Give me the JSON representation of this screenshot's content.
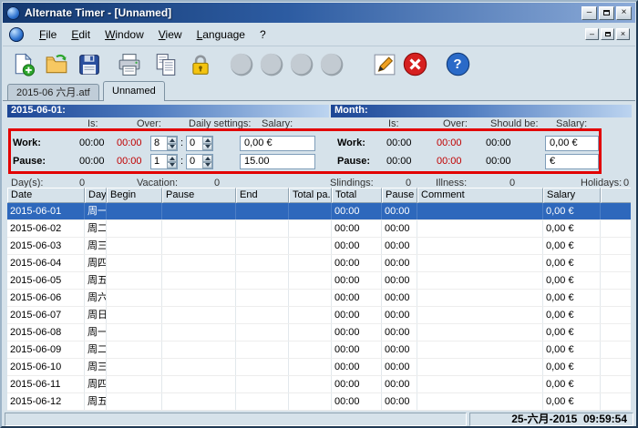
{
  "window": {
    "title": "Alternate Timer - [Unnamed]",
    "controls": {
      "minimize": "–",
      "close": "×"
    }
  },
  "menu": {
    "items": [
      "File",
      "Edit",
      "Window",
      "View",
      "Language",
      "?"
    ],
    "mdi": {
      "minimize": "–",
      "close": "×"
    }
  },
  "toolbar": {
    "buttons": [
      "new-file",
      "open-file",
      "save-file",
      "print",
      "copy",
      "lock",
      "daytype-circle-1",
      "daytype-circle-2",
      "daytype-circle-3",
      "daytype-circle-4",
      "edit-notes",
      "close-file",
      "help"
    ],
    "help_glyph": "?"
  },
  "tabs": [
    {
      "label": "2015-06 六月.atf"
    },
    {
      "label": "Unnamed"
    }
  ],
  "day_section": {
    "header": "2015-06-01:",
    "labels": {
      "is": "Is:",
      "over": "Over:",
      "daily": "Daily settings:",
      "salary": "Salary:"
    },
    "colon": ":",
    "work": {
      "label": "Work:",
      "is": "00:00",
      "over": "00:00",
      "hours": "8",
      "minutes": "0",
      "salary": "0,00 €"
    },
    "pause": {
      "label": "Pause:",
      "is": "00:00",
      "over": "00:00",
      "hours": "1",
      "minutes": "0",
      "salary": "15.00"
    }
  },
  "month_section": {
    "header": "Month:",
    "labels": {
      "is": "Is:",
      "over": "Over:",
      "should": "Should be:",
      "salary": "Salary:"
    },
    "work": {
      "label": "Work:",
      "is": "00:00",
      "over": "00:00",
      "should": "00:00",
      "salary": "0,00 €"
    },
    "pause": {
      "label": "Pause:",
      "is": "00:00",
      "over": "00:00",
      "should": "00:00",
      "salary": "€"
    }
  },
  "stats": {
    "days": {
      "label": "Day(s):",
      "value": "0"
    },
    "vacation": {
      "label": "Vacation:",
      "value": "0"
    },
    "slindings": {
      "label": "Slindings:",
      "value": "0"
    },
    "illness": {
      "label": "Illness:",
      "value": "0"
    },
    "holidays": {
      "label": "Holidays:",
      "value": "0"
    }
  },
  "table": {
    "columns": [
      "Date",
      "Day",
      "Begin",
      "Pause",
      "End",
      "Total pa...",
      "Total",
      "Pause",
      "Comment",
      "Salary"
    ],
    "rows": [
      {
        "date": "2015-06-01",
        "day": "周一",
        "begin": "",
        "pause_begin": "",
        "end": "",
        "total_pause": "",
        "total": "00:00",
        "pause": "00:00",
        "comment": "",
        "salary": "0,00 €",
        "selected": true
      },
      {
        "date": "2015-06-02",
        "day": "周二",
        "begin": "",
        "pause_begin": "",
        "end": "",
        "total_pause": "",
        "total": "00:00",
        "pause": "00:00",
        "comment": "",
        "salary": "0,00 €",
        "selected": false
      },
      {
        "date": "2015-06-03",
        "day": "周三",
        "begin": "",
        "pause_begin": "",
        "end": "",
        "total_pause": "",
        "total": "00:00",
        "pause": "00:00",
        "comment": "",
        "salary": "0,00 €",
        "selected": false
      },
      {
        "date": "2015-06-04",
        "day": "周四",
        "begin": "",
        "pause_begin": "",
        "end": "",
        "total_pause": "",
        "total": "00:00",
        "pause": "00:00",
        "comment": "",
        "salary": "0,00 €",
        "selected": false
      },
      {
        "date": "2015-06-05",
        "day": "周五",
        "begin": "",
        "pause_begin": "",
        "end": "",
        "total_pause": "",
        "total": "00:00",
        "pause": "00:00",
        "comment": "",
        "salary": "0,00 €",
        "selected": false
      },
      {
        "date": "2015-06-06",
        "day": "周六",
        "begin": "",
        "pause_begin": "",
        "end": "",
        "total_pause": "",
        "total": "00:00",
        "pause": "00:00",
        "comment": "",
        "salary": "0,00 €",
        "selected": false
      },
      {
        "date": "2015-06-07",
        "day": "周日",
        "begin": "",
        "pause_begin": "",
        "end": "",
        "total_pause": "",
        "total": "00:00",
        "pause": "00:00",
        "comment": "",
        "salary": "0,00 €",
        "selected": false
      },
      {
        "date": "2015-06-08",
        "day": "周一",
        "begin": "",
        "pause_begin": "",
        "end": "",
        "total_pause": "",
        "total": "00:00",
        "pause": "00:00",
        "comment": "",
        "salary": "0,00 €",
        "selected": false
      },
      {
        "date": "2015-06-09",
        "day": "周二",
        "begin": "",
        "pause_begin": "",
        "end": "",
        "total_pause": "",
        "total": "00:00",
        "pause": "00:00",
        "comment": "",
        "salary": "0,00 €",
        "selected": false
      },
      {
        "date": "2015-06-10",
        "day": "周三",
        "begin": "",
        "pause_begin": "",
        "end": "",
        "total_pause": "",
        "total": "00:00",
        "pause": "00:00",
        "comment": "",
        "salary": "0,00 €",
        "selected": false
      },
      {
        "date": "2015-06-11",
        "day": "周四",
        "begin": "",
        "pause_begin": "",
        "end": "",
        "total_pause": "",
        "total": "00:00",
        "pause": "00:00",
        "comment": "",
        "salary": "0,00 €",
        "selected": false
      },
      {
        "date": "2015-06-12",
        "day": "周五",
        "begin": "",
        "pause_begin": "",
        "end": "",
        "total_pause": "",
        "total": "00:00",
        "pause": "00:00",
        "comment": "",
        "salary": "0,00 €",
        "selected": false
      }
    ]
  },
  "statusbar": {
    "datetime": "25-六月-2015  09:59:54"
  }
}
